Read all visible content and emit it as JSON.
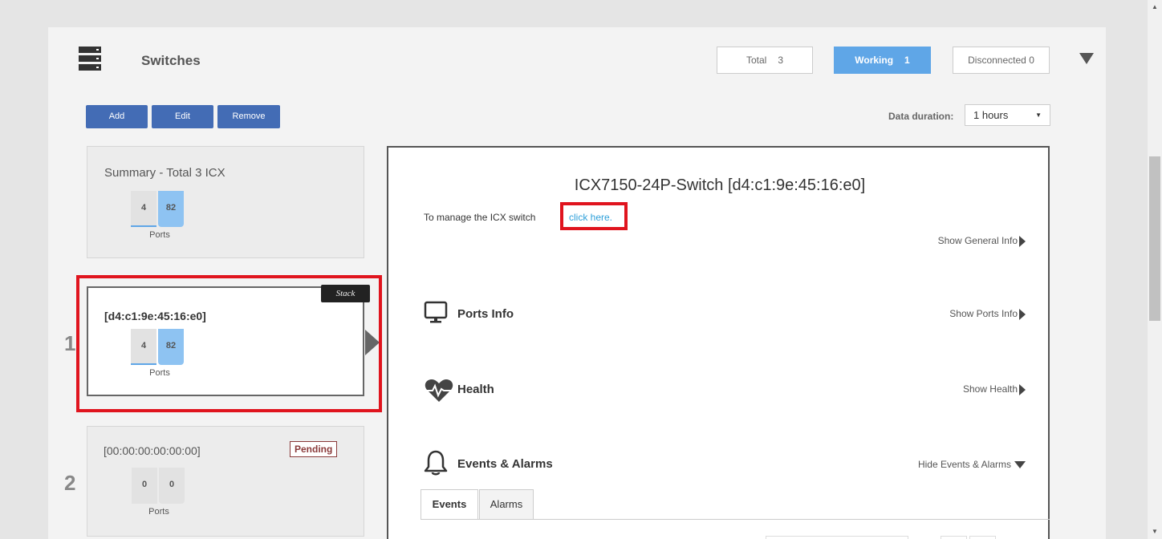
{
  "header": {
    "title": "Switches",
    "stats": {
      "total_label": "Total",
      "total_value": "3",
      "working_label": "Working",
      "working_value": "1",
      "disconnected_label": "Disconnected",
      "disconnected_value": "0"
    }
  },
  "toolbar": {
    "add_label": "Add",
    "edit_label": "Edit",
    "remove_label": "Remove",
    "duration_label": "Data duration:",
    "duration_value": "1 hours"
  },
  "cards": {
    "summary": {
      "title": "Summary - Total 3 ICX",
      "port_a": "4",
      "port_b": "82",
      "ports_label": "Ports"
    },
    "switch1": {
      "index": "1",
      "title": "[d4:c1:9e:45:16:e0]",
      "badge": "Stack",
      "port_a": "4",
      "port_b": "82",
      "ports_label": "Ports"
    },
    "switch2": {
      "index": "2",
      "title": "[00:00:00:00:00:00]",
      "badge": "Pending",
      "port_a": "0",
      "port_b": "0",
      "ports_label": "Ports"
    }
  },
  "detail": {
    "title": "ICX7150-24P-Switch [d4:c1:9e:45:16:e0]",
    "manage_text": "To manage the ICX switch",
    "manage_link": "click here.",
    "show_general": "Show General Info",
    "ports_title": "Ports Info",
    "show_ports": "Show Ports Info",
    "health_title": "Health",
    "show_health": "Show Health",
    "events_title": "Events & Alarms",
    "hide_events": "Hide Events & Alarms",
    "tabs": [
      "Events",
      "Alarms"
    ]
  },
  "icons": {
    "switch": "switch-stack-icon",
    "monitor": "monitor-icon",
    "heart": "heartbeat-icon",
    "bell": "bell-icon"
  },
  "colors": {
    "accent_blue": "#436cb5",
    "working_blue": "#5fa6e7",
    "link": "#2d9fd9",
    "highlight_red": "#e0141e"
  }
}
